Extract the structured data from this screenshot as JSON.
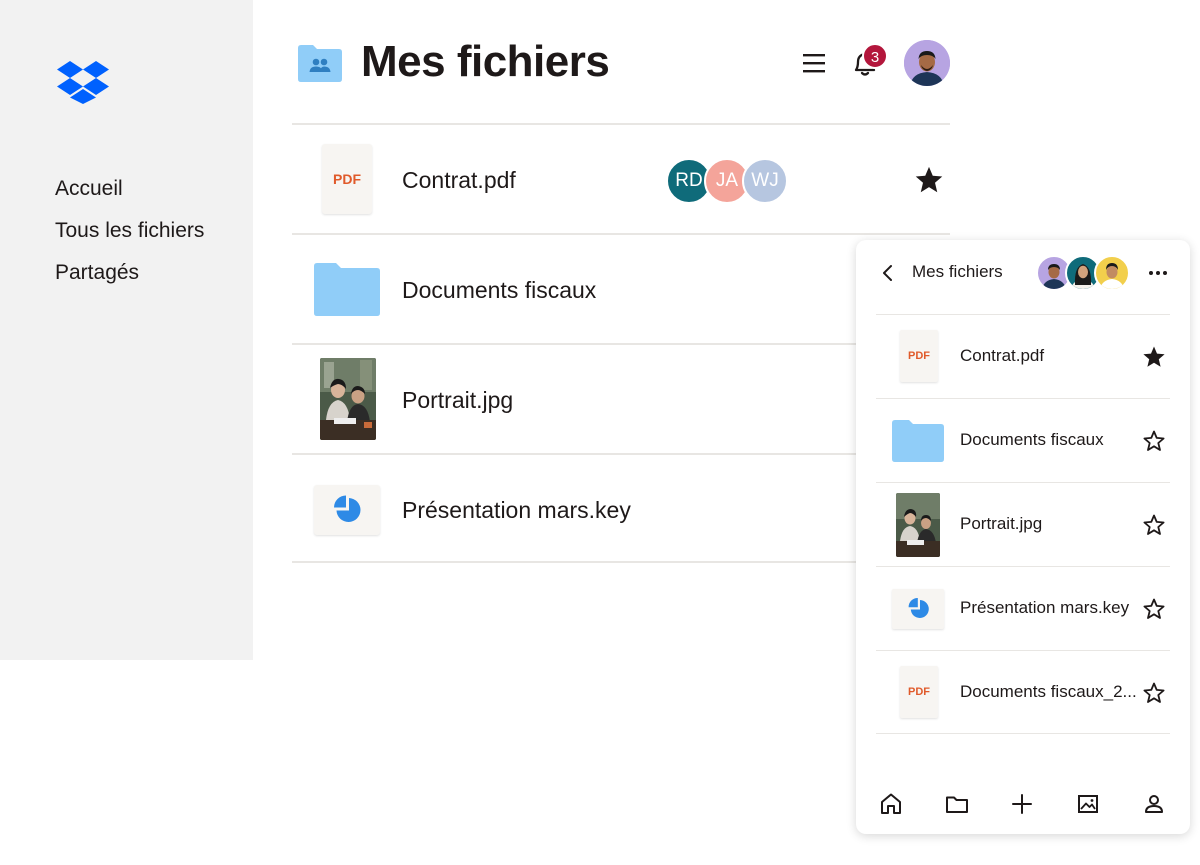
{
  "sidebar": {
    "logo": "dropbox-logo",
    "nav": [
      {
        "label": "Accueil"
      },
      {
        "label": "Tous les fichiers"
      },
      {
        "label": "Partagés"
      }
    ]
  },
  "header": {
    "title": "Mes fichiers",
    "notifications_count": "3"
  },
  "files": [
    {
      "name": "Contrat.pdf",
      "type": "pdf",
      "type_label": "PDF",
      "starred": true,
      "collaborators": [
        {
          "initials": "RD",
          "color": "#0f6b7a"
        },
        {
          "initials": "JA",
          "color": "#f4a49a"
        },
        {
          "initials": "WJ",
          "color": "#b6c6e0"
        }
      ]
    },
    {
      "name": "Documents fiscaux",
      "type": "folder"
    },
    {
      "name": "Portrait.jpg",
      "type": "image"
    },
    {
      "name": "Présentation mars.key",
      "type": "keynote"
    }
  ],
  "mobile": {
    "title": "Mes fichiers",
    "files": [
      {
        "name": "Contrat.pdf",
        "type": "pdf",
        "type_label": "PDF",
        "starred": true
      },
      {
        "name": "Documents fiscaux",
        "type": "folder",
        "starred": false
      },
      {
        "name": "Portrait.jpg",
        "type": "image",
        "starred": false
      },
      {
        "name": "Présentation mars.key",
        "type": "keynote",
        "starred": false
      },
      {
        "name": "Documents fiscaux_2...",
        "type": "pdf",
        "type_label": "PDF",
        "starred": false
      }
    ],
    "tabs": [
      "home-icon",
      "folder-icon",
      "add-icon",
      "photos-icon",
      "account-icon"
    ]
  },
  "colors": {
    "sidebar_bg": "#f2f2f2",
    "dropbox_blue": "#0061fe",
    "folder_blue": "#90cdf8",
    "pdf_red": "#e05a2b",
    "badge_red": "#b3163c",
    "divider": "#e8e6e3"
  }
}
